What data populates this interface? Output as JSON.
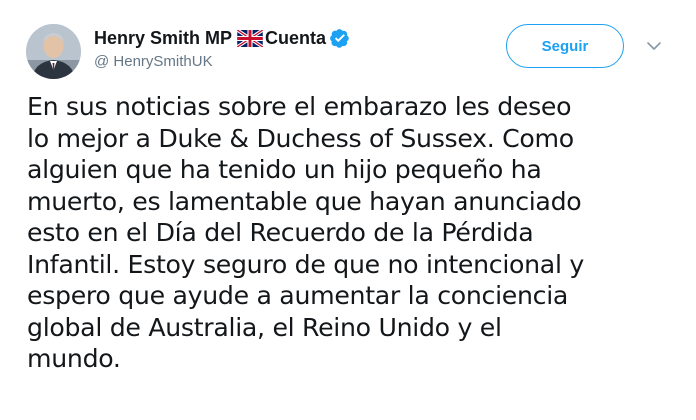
{
  "author": {
    "display_name": "Henry Smith MP",
    "label": "Cuenta",
    "handle": "@ HenrySmithUK",
    "verified": true
  },
  "icons": {
    "avatar": "user-avatar-photo",
    "flag": "uk-flag-icon",
    "verified": "verified-badge-icon",
    "caret": "chevron-down-icon"
  },
  "actions": {
    "follow_label": "Seguir"
  },
  "tweet": {
    "lines": [
      "En sus noticias sobre el embarazo les deseo",
      "lo mejor a Duke & Duchess of Sussex. Como",
      "alguien que ha tenido un hijo pequeño ha",
      "muerto, es lamentable que hayan anunciado",
      "esto en el Día del Recuerdo de la Pérdida",
      "Infantil. Estoy seguro de que no intencional y",
      "espero que ayude a aumentar la conciencia",
      "global de Australia, el Reino Unido y el",
      "mundo."
    ]
  },
  "colors": {
    "accent": "#1da1f2",
    "text": "#14171a",
    "secondary": "#657786"
  }
}
